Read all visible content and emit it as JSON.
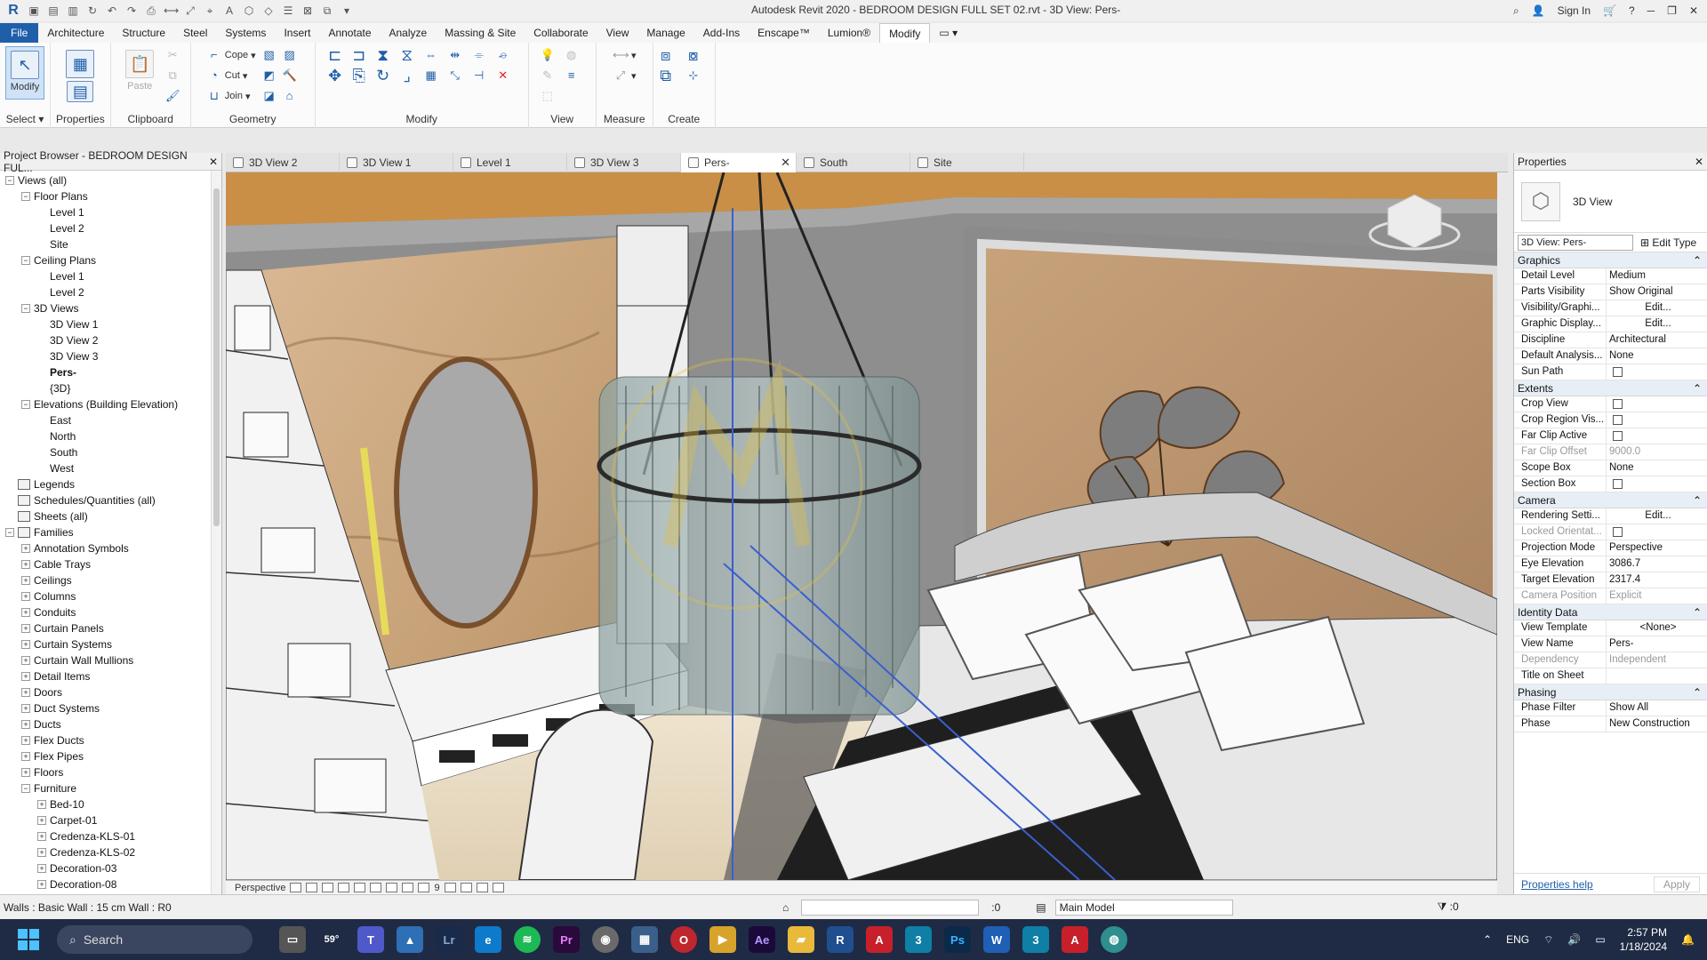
{
  "titlebar": {
    "title": "Autodesk Revit 2020 - BEDROOM DESIGN FULL SET 02.rvt - 3D View: Pers-",
    "sign_in": "Sign In",
    "app_letter": "R"
  },
  "menu": {
    "file": "File",
    "items": [
      "Architecture",
      "Structure",
      "Steel",
      "Systems",
      "Insert",
      "Annotate",
      "Analyze",
      "Massing & Site",
      "Collaborate",
      "View",
      "Manage",
      "Add-Ins",
      "Enscape™",
      "Lumion®",
      "Modify"
    ]
  },
  "ribbon": {
    "select_panel": {
      "modify_label": "Modify",
      "label": "Select"
    },
    "properties_panel": {
      "label": "Properties"
    },
    "clipboard_panel": {
      "paste_label": "Paste",
      "label": "Clipboard"
    },
    "geometry_panel": {
      "cope": "Cope",
      "cut": "Cut",
      "join": "Join",
      "label": "Geometry"
    },
    "modify_panel": {
      "label": "Modify"
    },
    "view_panel": {
      "label": "View"
    },
    "measure_panel": {
      "label": "Measure"
    },
    "create_panel": {
      "label": "Create"
    }
  },
  "project_browser": {
    "title": "Project Browser - BEDROOM DESIGN FUL...",
    "nodes": [
      {
        "label": "Views (all)",
        "indent": 0,
        "exp": "−"
      },
      {
        "label": "Floor Plans",
        "indent": 1,
        "exp": "−"
      },
      {
        "label": "Level 1",
        "indent": 2
      },
      {
        "label": "Level 2",
        "indent": 2
      },
      {
        "label": "Site",
        "indent": 2
      },
      {
        "label": "Ceiling Plans",
        "indent": 1,
        "exp": "−"
      },
      {
        "label": "Level 1",
        "indent": 2
      },
      {
        "label": "Level 2",
        "indent": 2
      },
      {
        "label": "3D Views",
        "indent": 1,
        "exp": "−"
      },
      {
        "label": "3D View 1",
        "indent": 2
      },
      {
        "label": "3D View 2",
        "indent": 2
      },
      {
        "label": "3D View 3",
        "indent": 2
      },
      {
        "label": "Pers-",
        "indent": 2,
        "bold": true
      },
      {
        "label": "{3D}",
        "indent": 2
      },
      {
        "label": "Elevations (Building Elevation)",
        "indent": 1,
        "exp": "−"
      },
      {
        "label": "East",
        "indent": 2
      },
      {
        "label": "North",
        "indent": 2
      },
      {
        "label": "South",
        "indent": 2
      },
      {
        "label": "West",
        "indent": 2
      },
      {
        "label": "Legends",
        "indent": 0,
        "icon": true
      },
      {
        "label": "Schedules/Quantities (all)",
        "indent": 0,
        "icon": true
      },
      {
        "label": "Sheets (all)",
        "indent": 0,
        "icon": true
      },
      {
        "label": "Families",
        "indent": 0,
        "exp": "−",
        "icon": true
      },
      {
        "label": "Annotation Symbols",
        "indent": 1,
        "exp": "+"
      },
      {
        "label": "Cable Trays",
        "indent": 1,
        "exp": "+"
      },
      {
        "label": "Ceilings",
        "indent": 1,
        "exp": "+"
      },
      {
        "label": "Columns",
        "indent": 1,
        "exp": "+"
      },
      {
        "label": "Conduits",
        "indent": 1,
        "exp": "+"
      },
      {
        "label": "Curtain Panels",
        "indent": 1,
        "exp": "+"
      },
      {
        "label": "Curtain Systems",
        "indent": 1,
        "exp": "+"
      },
      {
        "label": "Curtain Wall Mullions",
        "indent": 1,
        "exp": "+"
      },
      {
        "label": "Detail Items",
        "indent": 1,
        "exp": "+"
      },
      {
        "label": "Doors",
        "indent": 1,
        "exp": "+"
      },
      {
        "label": "Duct Systems",
        "indent": 1,
        "exp": "+"
      },
      {
        "label": "Ducts",
        "indent": 1,
        "exp": "+"
      },
      {
        "label": "Flex Ducts",
        "indent": 1,
        "exp": "+"
      },
      {
        "label": "Flex Pipes",
        "indent": 1,
        "exp": "+"
      },
      {
        "label": "Floors",
        "indent": 1,
        "exp": "+"
      },
      {
        "label": "Furniture",
        "indent": 1,
        "exp": "−"
      },
      {
        "label": "Bed-10",
        "indent": 2,
        "exp": "+"
      },
      {
        "label": "Carpet-01",
        "indent": 2,
        "exp": "+"
      },
      {
        "label": "Credenza-KLS-01",
        "indent": 2,
        "exp": "+"
      },
      {
        "label": "Credenza-KLS-02",
        "indent": 2,
        "exp": "+"
      },
      {
        "label": "Decoration-03",
        "indent": 2,
        "exp": "+"
      },
      {
        "label": "Decoration-08",
        "indent": 2,
        "exp": "+"
      }
    ]
  },
  "tabs": [
    {
      "label": "3D View 2"
    },
    {
      "label": "3D View 1"
    },
    {
      "label": "Level 1"
    },
    {
      "label": "3D View 3"
    },
    {
      "label": "Pers-",
      "active": true
    },
    {
      "label": "South"
    },
    {
      "label": "Site"
    }
  ],
  "viewbar": {
    "mode": "Perspective",
    "scale": "9"
  },
  "properties": {
    "title": "Properties",
    "type_name": "3D View",
    "instance_selector": "3D View: Pers-",
    "edit_type": "Edit Type",
    "groups": [
      {
        "name": "Graphics",
        "rows": [
          {
            "k": "Detail Level",
            "v": "Medium"
          },
          {
            "k": "Parts Visibility",
            "v": "Show Original"
          },
          {
            "k": "Visibility/Graphi...",
            "v": "Edit...",
            "btn": true
          },
          {
            "k": "Graphic Display...",
            "v": "Edit...",
            "btn": true
          },
          {
            "k": "Discipline",
            "v": "Architectural"
          },
          {
            "k": "Default Analysis...",
            "v": "None"
          },
          {
            "k": "Sun Path",
            "chk": true
          }
        ]
      },
      {
        "name": "Extents",
        "rows": [
          {
            "k": "Crop View",
            "chk": true
          },
          {
            "k": "Crop Region Vis...",
            "chk": true
          },
          {
            "k": "Far Clip Active",
            "chk": true
          },
          {
            "k": "Far Clip Offset",
            "v": "9000.0",
            "dis": true
          },
          {
            "k": "Scope Box",
            "v": "None"
          },
          {
            "k": "Section Box",
            "chk": true
          }
        ]
      },
      {
        "name": "Camera",
        "rows": [
          {
            "k": "Rendering Setti...",
            "v": "Edit...",
            "btn": true
          },
          {
            "k": "Locked Orientat...",
            "chk": true,
            "dis": true
          },
          {
            "k": "Projection Mode",
            "v": "Perspective"
          },
          {
            "k": "Eye Elevation",
            "v": "3086.7"
          },
          {
            "k": "Target Elevation",
            "v": "2317.4"
          },
          {
            "k": "Camera Position",
            "v": "Explicit",
            "dis": true
          }
        ]
      },
      {
        "name": "Identity Data",
        "rows": [
          {
            "k": "View Template",
            "v": "<None>",
            "btn": true
          },
          {
            "k": "View Name",
            "v": "Pers-"
          },
          {
            "k": "Dependency",
            "v": "Independent",
            "dis": true
          },
          {
            "k": "Title on Sheet",
            "v": ""
          }
        ]
      },
      {
        "name": "Phasing",
        "rows": [
          {
            "k": "Phase Filter",
            "v": "Show All"
          },
          {
            "k": "Phase",
            "v": "New Construction"
          }
        ]
      }
    ],
    "help": "Properties help",
    "apply": "Apply"
  },
  "status": {
    "left": "Walls : Basic Wall : 15 cm Wall : R0",
    "worksets": ":0",
    "model": "Main Model",
    "filter": ":0"
  },
  "taskbar": {
    "search": "Search",
    "weather": "59°",
    "lang": "ENG",
    "time": "2:57 PM",
    "date": "1/18/2024"
  }
}
